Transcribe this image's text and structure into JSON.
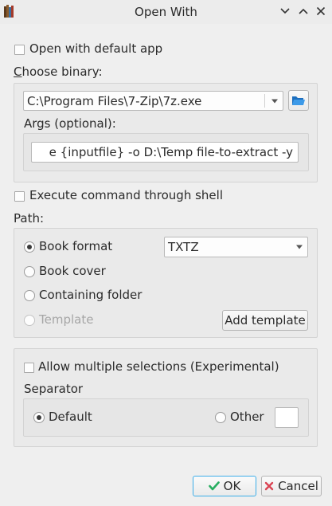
{
  "window": {
    "title": "Open With"
  },
  "default_app": {
    "label": "Open with default app",
    "checked": false
  },
  "binary": {
    "label": "Choose binary:",
    "value": "C:\\Program Files\\7-Zip\\7z.exe",
    "args_label": "Args (optional):",
    "args_value": "e {inputfile} -o D:\\Temp file-to-extract -y"
  },
  "shell": {
    "label": "Execute command through shell",
    "checked": false
  },
  "path": {
    "label": "Path:",
    "options": [
      {
        "label": "Book format",
        "checked": true,
        "enabled": true
      },
      {
        "label": "Book cover",
        "checked": false,
        "enabled": true
      },
      {
        "label": "Containing folder",
        "checked": false,
        "enabled": true
      },
      {
        "label": "Template",
        "checked": false,
        "enabled": false
      }
    ],
    "format_value": "TXTZ",
    "add_template_label": "Add template"
  },
  "multiple": {
    "label": "Allow multiple selections (Experimental)",
    "checked": false,
    "separator_label": "Separator",
    "default_label": "Default",
    "other_label": "Other",
    "other_value": ""
  },
  "buttons": {
    "ok": "OK",
    "cancel": "Cancel"
  },
  "colors": {
    "ok_check": "#27ae60",
    "cancel_x": "#da4453",
    "focus": "#3daee9"
  }
}
